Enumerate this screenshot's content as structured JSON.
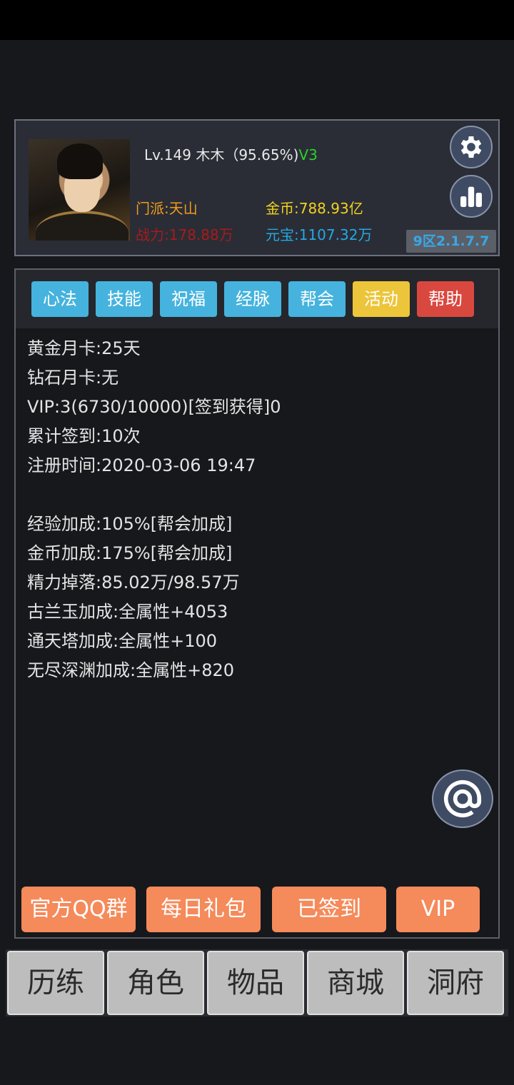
{
  "player": {
    "level_line": "Lv.149 木木（95.65%)",
    "vip_badge": "V3",
    "sect": "门派:天山",
    "power": "战力:178.88万",
    "gold": "金币:788.93亿",
    "yuanbao": "元宝:1107.32万",
    "server": "9区2.1.7.7"
  },
  "tabs": [
    {
      "label": "心法",
      "color": "#45b3de"
    },
    {
      "label": "技能",
      "color": "#45b3de"
    },
    {
      "label": "祝福",
      "color": "#45b3de"
    },
    {
      "label": "经脉",
      "color": "#45b3de"
    },
    {
      "label": "帮会",
      "color": "#45b3de"
    },
    {
      "label": "活动",
      "color": "#ecc53a"
    },
    {
      "label": "帮助",
      "color": "#d9483f"
    }
  ],
  "info_lines": [
    "黄金月卡:25天",
    "钻石月卡:无",
    "VIP:3(6730/10000)[签到获得]0",
    "累计签到:10次",
    "注册时间:2020-03-06 19:47"
  ],
  "bonus_lines": [
    "经验加成:105%[帮会加成]",
    "金币加成:175%[帮会加成]",
    "精力掉落:85.02万/98.57万",
    "古兰玉加成:全属性+4053",
    "通天塔加成:全属性+100",
    "无尽深渊加成:全属性+820"
  ],
  "actions": [
    "官方QQ群",
    "每日礼包",
    "已签到",
    "VIP"
  ],
  "nav": [
    "历练",
    "角色",
    "物品",
    "商城",
    "洞府"
  ],
  "icons": {
    "settings": "gear-icon",
    "stats": "bar-chart-icon",
    "at": "at-icon"
  }
}
